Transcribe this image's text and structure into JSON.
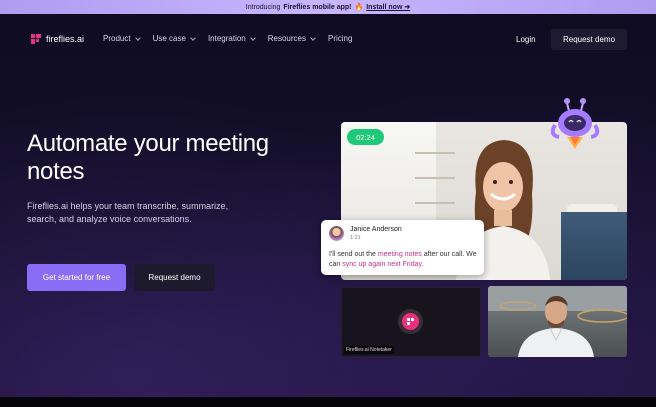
{
  "banner": {
    "prefix": "Introducing",
    "highlight": "Fireflies mobile app!",
    "emoji": "🔥",
    "link": "Install now ➔"
  },
  "nav": {
    "logo_text": "fireflies.ai",
    "items": [
      {
        "label": "Product",
        "has_dropdown": true
      },
      {
        "label": "Use case",
        "has_dropdown": true
      },
      {
        "label": "Integration",
        "has_dropdown": true
      },
      {
        "label": "Resources",
        "has_dropdown": true
      },
      {
        "label": "Pricing",
        "has_dropdown": false
      }
    ],
    "login": "Login",
    "request_demo": "Request demo"
  },
  "hero": {
    "headline": "Automate your meeting notes",
    "subtext": "Fireflies.ai helps your team transcribe, summarize, search, and analyze voice conversations.",
    "cta_primary": "Get started for free",
    "cta_secondary": "Request demo"
  },
  "video": {
    "timer": "02:24",
    "chat": {
      "name": "Janice Anderson",
      "time": "1:21",
      "msg_1": "I'll send out the ",
      "msg_hl_1": "meeting notes",
      "msg_2": " after our call. We can ",
      "msg_hl_2": "sync up again next Friday",
      "msg_3": "."
    },
    "notetaker_label": "Fireflies.ai Notetaker"
  },
  "colors": {
    "accent": "#8a6cf5",
    "brand_pink": "#e8327f",
    "timer_green": "#20c97a",
    "highlight": "#c0358f",
    "background": "#0d0a1c"
  }
}
